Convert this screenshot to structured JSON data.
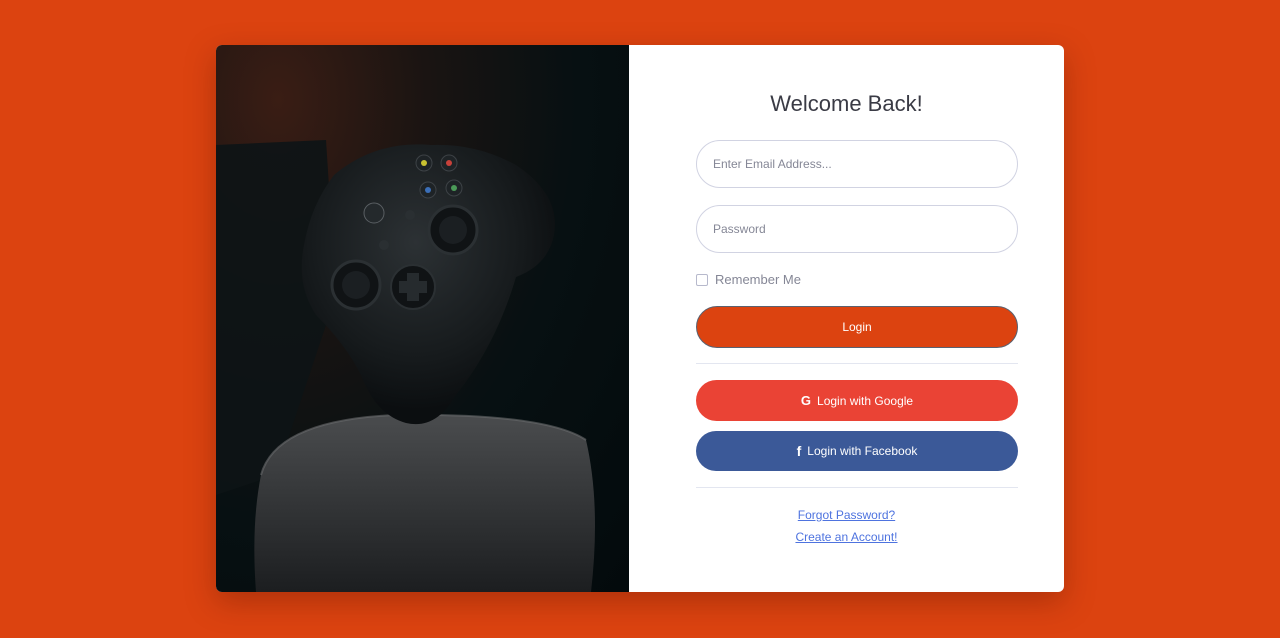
{
  "login": {
    "title": "Welcome Back!",
    "email_placeholder": "Enter Email Address...",
    "password_placeholder": "Password",
    "remember_label": "Remember Me",
    "login_label": "Login",
    "google_label": "Login with Google",
    "facebook_label": "Login with Facebook",
    "forgot_link": "Forgot Password?",
    "create_link": "Create an Account!"
  },
  "icons": {
    "google": "G",
    "facebook": "f"
  },
  "colors": {
    "background": "#dc4310",
    "login_button": "#dc4310",
    "google_button": "#ea4335",
    "facebook_button": "#3b5998",
    "link": "#4e73df"
  }
}
